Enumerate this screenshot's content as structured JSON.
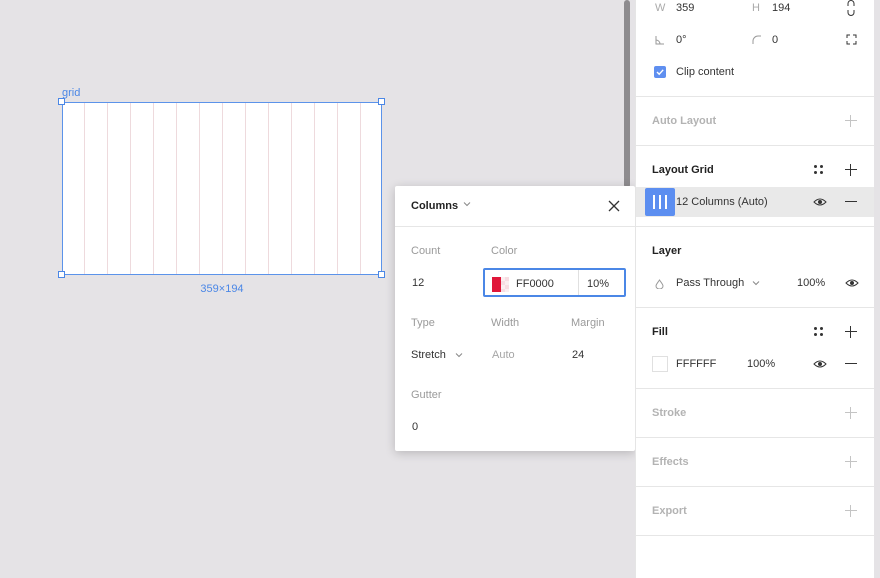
{
  "canvas": {
    "frame_name": "grid",
    "frame_size_label": "359×194",
    "grid_columns": 12,
    "grid_color": "#FF0000"
  },
  "popover": {
    "title": "Columns",
    "count_label": "Count",
    "count_value": "12",
    "color_label": "Color",
    "color_hex": "FF0000",
    "color_opacity": "10%",
    "type_label": "Type",
    "type_value": "Stretch",
    "width_label": "Width",
    "width_value": "Auto",
    "margin_label": "Margin",
    "margin_value": "24",
    "gutter_label": "Gutter",
    "gutter_value": "0"
  },
  "panel": {
    "w_label": "W",
    "w_value": "359",
    "h_label": "H",
    "h_value": "194",
    "rotation_value": "0°",
    "corner_value": "0",
    "clip_content_label": "Clip content",
    "clip_content_checked": true,
    "auto_layout": {
      "title": "Auto Layout"
    },
    "layout_grid": {
      "title": "Layout Grid",
      "item_label": "12 Columns (Auto)"
    },
    "layer": {
      "title": "Layer",
      "blend_mode": "Pass Through",
      "opacity": "100%"
    },
    "fill": {
      "title": "Fill",
      "hex": "FFFFFF",
      "opacity": "100%"
    },
    "stroke": {
      "title": "Stroke"
    },
    "effects": {
      "title": "Effects"
    },
    "export": {
      "title": "Export"
    }
  },
  "colors": {
    "accent": "#4B87E6",
    "selection": "#5C8EF0",
    "canvas_bg": "#E5E3E6"
  }
}
